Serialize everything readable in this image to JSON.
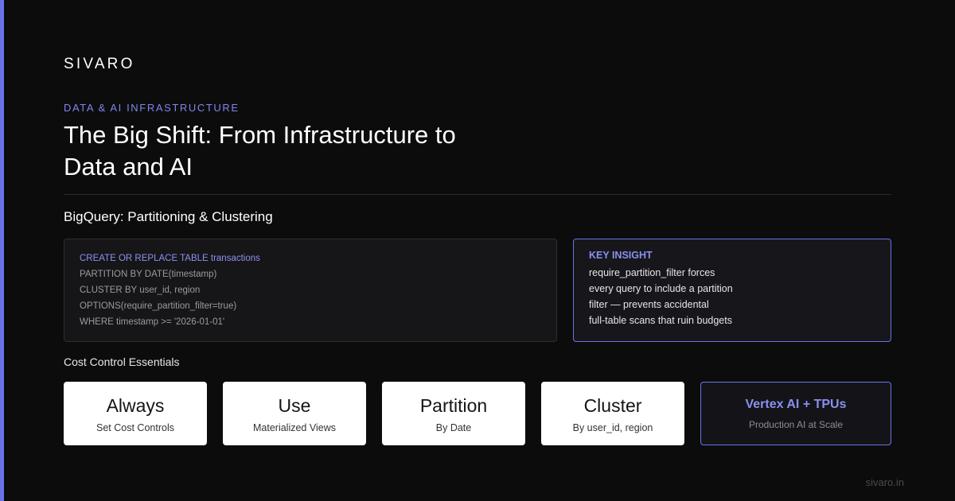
{
  "colors": {
    "accent": "#6b72e8",
    "background": "#0c0c0c"
  },
  "brand": "SIVARO",
  "eyebrow": "DATA & AI INFRASTRUCTURE",
  "title": "The Big Shift: From Infrastructure to Data and AI",
  "section_title": "BigQuery: Partitioning & Clustering",
  "code": {
    "lines": [
      "CREATE OR REPLACE TABLE transactions",
      "PARTITION BY DATE(timestamp)",
      "CLUSTER BY user_id, region",
      "OPTIONS(require_partition_filter=true)",
      "WHERE timestamp >= '2026-01-01'"
    ]
  },
  "insight": {
    "heading": "KEY INSIGHT",
    "lines": [
      "require_partition_filter forces",
      "every query to include a partition",
      "filter — prevents accidental",
      "full-table scans that ruin budgets"
    ]
  },
  "cards_title": "Cost Control Essentials",
  "cards": [
    {
      "big": "Always",
      "small": "Set Cost Controls"
    },
    {
      "big": "Use",
      "small": "Materialized Views"
    },
    {
      "big": "Partition",
      "small": "By Date"
    },
    {
      "big": "Cluster",
      "small": "By user_id, region"
    },
    {
      "big": "Vertex AI + TPUs",
      "small": "Production AI at Scale"
    }
  ],
  "footer": "sivaro.in"
}
